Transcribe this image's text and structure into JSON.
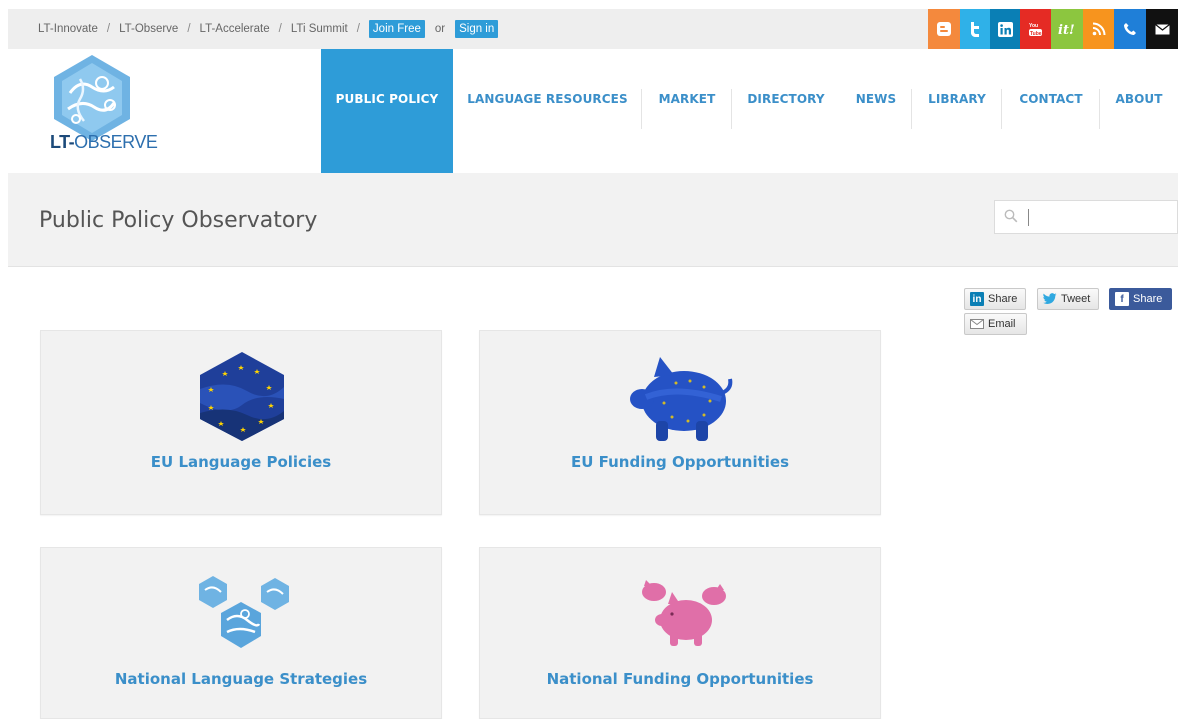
{
  "topbar": {
    "breadcrumbs": [
      "LT-Innovate",
      "LT-Observe",
      "LT-Accelerate",
      "LTi Summit"
    ],
    "join_label": "Join Free",
    "or_label": "or",
    "signin_label": "Sign in",
    "social": [
      "blogger-icon",
      "twitter-icon",
      "linkedin-icon",
      "youtube-icon",
      "itunes-icon",
      "rss-icon",
      "phone-icon",
      "mail-icon"
    ]
  },
  "logo": {
    "text_prefix": "LT-",
    "text_suffix": "OBSERVE"
  },
  "nav": {
    "items": [
      "PUBLIC POLICY",
      "LANGUAGE RESOURCES",
      "MARKET",
      "DIRECTORY",
      "NEWS",
      "LIBRARY",
      "CONTACT",
      "ABOUT"
    ],
    "active": "PUBLIC POLICY"
  },
  "page": {
    "title": "Public Policy Observatory"
  },
  "search": {
    "placeholder": ""
  },
  "share": {
    "linkedin": "Share",
    "twitter": "Tweet",
    "facebook": "Share",
    "email": "Email"
  },
  "cards": [
    {
      "label": "EU Language Policies",
      "icon": "eu-flag-hexagon-icon"
    },
    {
      "label": "EU Funding Opportunities",
      "icon": "eu-piggy-bank-icon"
    },
    {
      "label": "National Language Strategies",
      "icon": "national-strategies-icon"
    },
    {
      "label": "National Funding Opportunities",
      "icon": "pink-piggy-banks-icon"
    }
  ],
  "colors": {
    "accent": "#2e9cd8",
    "link": "#3b8fc9",
    "band": "#f2f2f2"
  }
}
